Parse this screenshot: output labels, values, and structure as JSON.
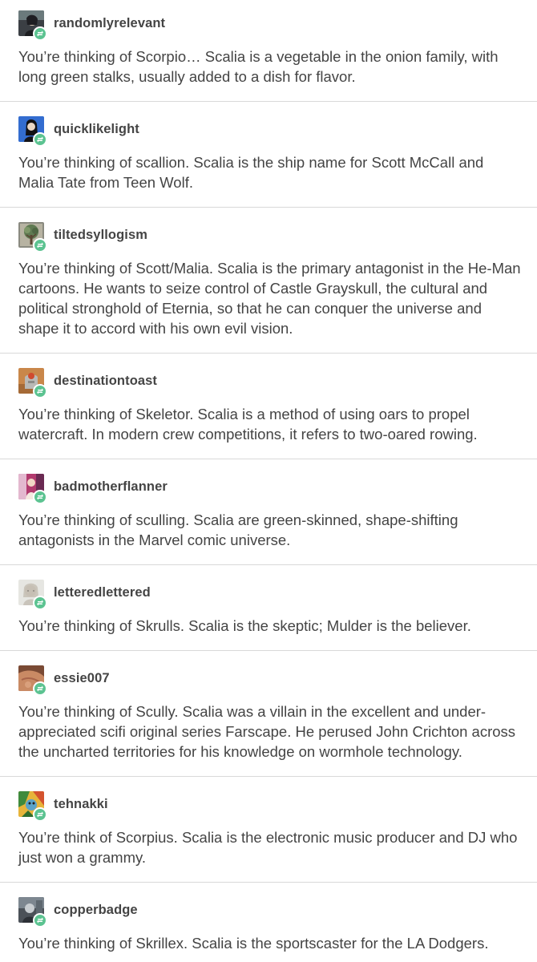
{
  "posts": [
    {
      "username": "randomlyrelevant",
      "avatar_icon": "avatar-dark-portrait-icon",
      "badge_icon": "reblog-icon",
      "text": "You’re thinking of Scorpio… Scalia is a vegetable in the onion family, with long green stalks, usually added to a dish for flavor."
    },
    {
      "username": "quicklikelight",
      "avatar_icon": "avatar-blue-portrait-icon",
      "badge_icon": "reblog-icon",
      "text": "You’re thinking of scallion. Scalia is the ship name for Scott McCall and Malia Tate from Teen Wolf."
    },
    {
      "username": "tiltedsyllogism",
      "avatar_icon": "avatar-tree-icon",
      "badge_icon": "reblog-icon",
      "text": "You’re thinking of Scott/Malia. Scalia is the primary antagonist in the He-Man cartoons. He wants to seize control of Castle Grayskull, the cultural and political stronghold of Eternia, so that he can conquer the universe and shape it to accord with his own evil vision."
    },
    {
      "username": "destinationtoast",
      "avatar_icon": "avatar-toast-icon",
      "badge_icon": "reblog-icon",
      "text": "You’re thinking of Skeletor. Scalia is a method of using oars to propel watercraft. In modern crew competitions, it refers to two-oared rowing."
    },
    {
      "username": "badmotherflanner",
      "avatar_icon": "avatar-pink-portrait-icon",
      "badge_icon": "reblog-icon",
      "text": "You’re thinking of sculling. Scalia are green-skinned, shape-shifting antagonists in the Marvel comic universe."
    },
    {
      "username": "letteredlettered",
      "avatar_icon": "avatar-sketch-portrait-icon",
      "badge_icon": "reblog-icon",
      "text": "You’re thinking of Skrulls.  Scalia is the skeptic; Mulder is the believer."
    },
    {
      "username": "essie007",
      "avatar_icon": "avatar-skin-closeup-icon",
      "badge_icon": "reblog-icon",
      "text": "You’re thinking of Scully. Scalia was a villain in the excellent and under-appreciated scifi original series Farscape. He perused John Crichton across the uncharted territories for his knowledge on wormhole technology."
    },
    {
      "username": "tehnakki",
      "avatar_icon": "avatar-cartoon-icon",
      "badge_icon": "reblog-icon",
      "text": "You’re think of Scorpius. Scalia is the electronic music producer and DJ who just won a grammy."
    },
    {
      "username": "copperbadge",
      "avatar_icon": "avatar-gray-portrait-icon",
      "badge_icon": "reblog-icon",
      "text": "You’re thinking of Skrillex. Scalia is the sportscaster for the LA Dodgers."
    }
  ],
  "colors": {
    "text": "#444444",
    "divider": "#d9d9d9",
    "reblog_badge": "#5cc391"
  }
}
